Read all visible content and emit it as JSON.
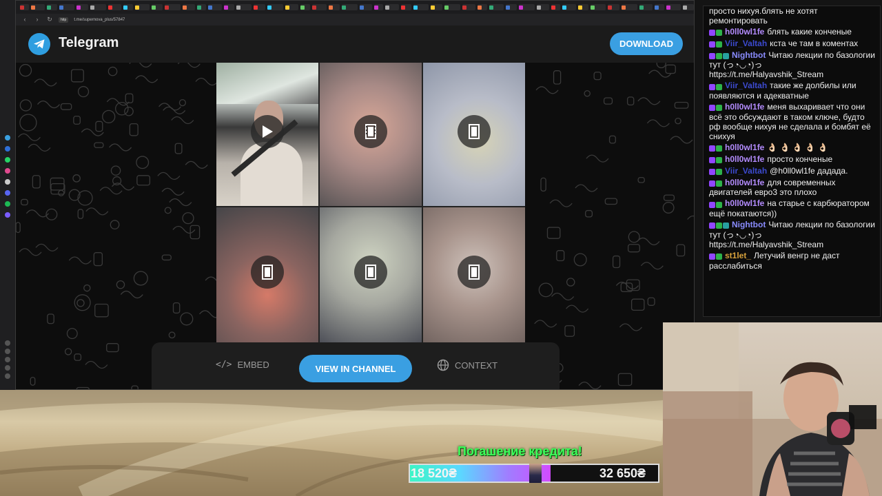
{
  "browser": {
    "url": "t.me/supernova_plus/57847",
    "url_badge": "http"
  },
  "telegram": {
    "brand": "Telegram",
    "download_label": "DOWNLOAD",
    "embed_label": "EMBED",
    "view_channel_label": "VIEW IN CHANNEL",
    "context_label": "CONTEXT",
    "accent_color": "#3a9fe2"
  },
  "chat": {
    "messages": [
      {
        "user": "",
        "text": "просто нихуя.блять не хотят ремонтировать",
        "color": "#ffffff"
      },
      {
        "user": "h0ll0wl1fe",
        "text": "блять какие конченые",
        "color": "#b48cff"
      },
      {
        "user": "Viir_Valtah",
        "text": "кста че там в коментах",
        "color": "#3c4ad0"
      },
      {
        "user": "Nightbot",
        "text": "Читаю лекции по базологии тут (っ◔◡◔)っ https://t.me/Halyavshik_Stream",
        "color": "#8a8cff"
      },
      {
        "user": "Viir_Valtah",
        "text": "такие же долбилы или появляются и адекватные",
        "color": "#3c4ad0"
      },
      {
        "user": "h0ll0wl1fe",
        "text": "меня выхаривает что они всё это обсуждают в таком ключе, будто рф вообще нихуя не сделала и бомбят её снихуя",
        "color": "#b48cff"
      },
      {
        "user": "h0ll0wl1fe",
        "text": "👌🏻 👌🏻 👌🏻 👌🏻 👌🏻",
        "color": "#b48cff"
      },
      {
        "user": "h0ll0wl1fe",
        "text": "просто конченые",
        "color": "#b48cff"
      },
      {
        "user": "Viir_Valtah",
        "text": "@h0ll0wl1fe дадада.",
        "color": "#3c4ad0"
      },
      {
        "user": "h0ll0wl1fe",
        "text": "для современных двигателей евро3 это плохо",
        "color": "#b48cff"
      },
      {
        "user": "h0ll0wl1fe",
        "text": "на старье с карбюратором ещё покатаются))",
        "color": "#b48cff"
      },
      {
        "user": "Nightbot",
        "text": "Читаю лекции по базологии тут (っ◔◡◔)っ https://t.me/Halyavshik_Stream",
        "color": "#8a8cff"
      },
      {
        "user": "st1let_",
        "text": "Летучий венгр не даст расслабиться",
        "color": "#d8a23c"
      }
    ]
  },
  "overlay": {
    "credit_title": "Погашение кредита!",
    "credit_paid": "18 520₴",
    "credit_total": "32 650₴",
    "credit_progress": 0.567
  }
}
